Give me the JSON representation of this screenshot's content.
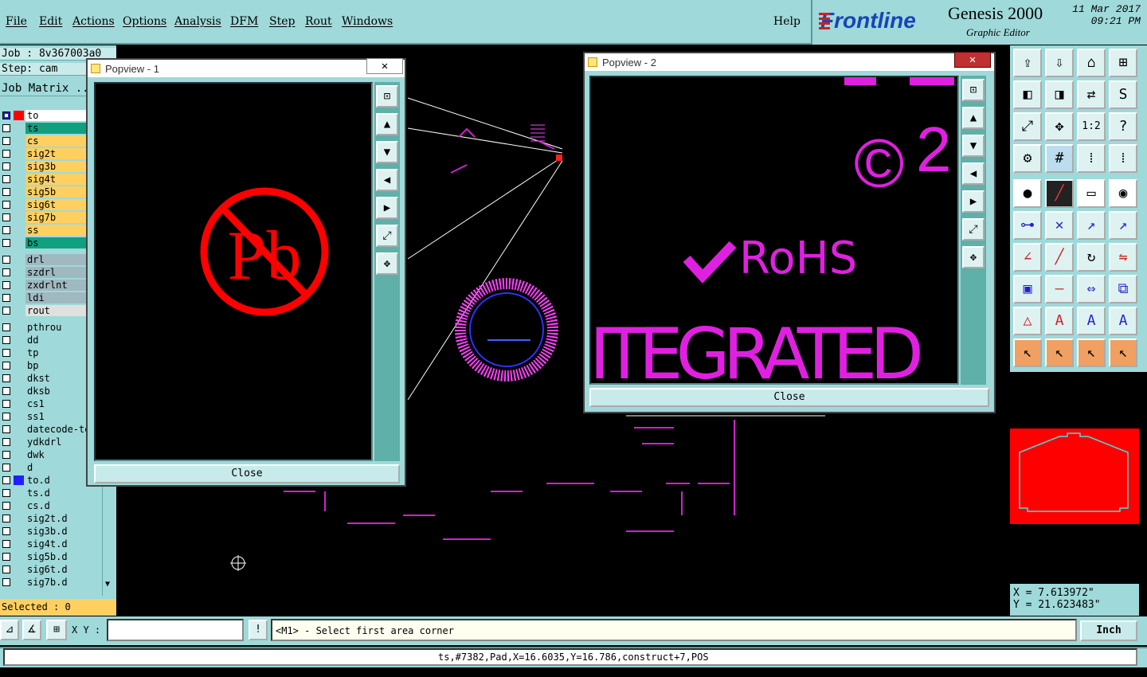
{
  "menu": {
    "items": [
      "File",
      "Edit",
      "Actions",
      "Options",
      "Analysis",
      "DFM",
      "Step",
      "Rout",
      "Windows"
    ],
    "help": "Help"
  },
  "brand": {
    "logo": "Frontline",
    "product": "Genesis 2000",
    "subtitle": "Graphic Editor",
    "date": "11 Mar 2017",
    "time": "09:21 PM"
  },
  "job": {
    "job_label": "Job : 8v367003a0",
    "step_label": "Step: cam",
    "matrix_label": "Job Matrix ..."
  },
  "layers": [
    {
      "name": "to",
      "color": "#ff0000",
      "bg": "#ffffff"
    },
    {
      "name": "ts",
      "color": "",
      "bg": "#10a080"
    },
    {
      "name": "cs",
      "color": "",
      "bg": "#ffd060"
    },
    {
      "name": "sig2t",
      "color": "",
      "bg": "#ffd060"
    },
    {
      "name": "sig3b",
      "color": "",
      "bg": "#ffd060"
    },
    {
      "name": "sig4t",
      "color": "",
      "bg": "#ffd060"
    },
    {
      "name": "sig5b",
      "color": "",
      "bg": "#ffd060"
    },
    {
      "name": "sig6t",
      "color": "",
      "bg": "#ffd060"
    },
    {
      "name": "sig7b",
      "color": "",
      "bg": "#ffd060"
    },
    {
      "name": "ss",
      "color": "",
      "bg": "#ffd060"
    },
    {
      "name": "bs",
      "color": "",
      "bg": "#10a080"
    },
    {
      "name": "drl",
      "color": "",
      "bg": "#a0b8c0"
    },
    {
      "name": "szdrl",
      "color": "",
      "bg": "#a0b8c0"
    },
    {
      "name": "zxdrlnt",
      "color": "",
      "bg": "#a0b8c0"
    },
    {
      "name": "ldi",
      "color": "",
      "bg": "#a0b8c0"
    },
    {
      "name": "rout",
      "color": "",
      "bg": "#e0e0e0"
    },
    {
      "name": "pthrou",
      "color": "",
      "bg": "#9fd9d9"
    },
    {
      "name": "dd",
      "color": "",
      "bg": "#9fd9d9"
    },
    {
      "name": "tp",
      "color": "",
      "bg": "#9fd9d9"
    },
    {
      "name": "bp",
      "color": "",
      "bg": "#9fd9d9"
    },
    {
      "name": "dkst",
      "color": "",
      "bg": "#9fd9d9"
    },
    {
      "name": "dksb",
      "color": "",
      "bg": "#9fd9d9"
    },
    {
      "name": "cs1",
      "color": "",
      "bg": "#9fd9d9"
    },
    {
      "name": "ss1",
      "color": "",
      "bg": "#9fd9d9"
    },
    {
      "name": "datecode-te",
      "color": "",
      "bg": "#9fd9d9"
    },
    {
      "name": "ydkdrl",
      "color": "",
      "bg": "#9fd9d9"
    },
    {
      "name": "dwk",
      "color": "",
      "bg": "#9fd9d9"
    },
    {
      "name": "d",
      "color": "",
      "bg": "#9fd9d9"
    },
    {
      "name": "to.d",
      "color": "#2020ff",
      "bg": "#9fd9d9"
    },
    {
      "name": "ts.d",
      "color": "",
      "bg": "#9fd9d9"
    },
    {
      "name": "cs.d",
      "color": "",
      "bg": "#9fd9d9"
    },
    {
      "name": "sig2t.d",
      "color": "",
      "bg": "#9fd9d9"
    },
    {
      "name": "sig3b.d",
      "color": "",
      "bg": "#9fd9d9"
    },
    {
      "name": "sig4t.d",
      "color": "",
      "bg": "#9fd9d9"
    },
    {
      "name": "sig5b.d",
      "color": "",
      "bg": "#9fd9d9"
    },
    {
      "name": "sig6t.d",
      "color": "",
      "bg": "#9fd9d9"
    },
    {
      "name": "sig7b.d",
      "color": "",
      "bg": "#9fd9d9"
    }
  ],
  "selected": "Selected : 0",
  "popview1": {
    "title": "Popview - 1",
    "close": "Close",
    "symbol_text": "Pb"
  },
  "popview2": {
    "title": "Popview - 2",
    "close": "Close",
    "copyright": "©",
    "superscript": "2",
    "rohs": "RoHS",
    "integrated": "ITEGRATED"
  },
  "coords": {
    "x": "X = 7.613972\"",
    "y": "Y = 21.623483\""
  },
  "command": {
    "xy_label": "X Y :",
    "xy_value": "",
    "prompt": "<M1> - Select first area corner",
    "units": "Inch"
  },
  "status": "ts,#7382,Pad,X=16.6035,Y=16.786,construct+7,POS"
}
